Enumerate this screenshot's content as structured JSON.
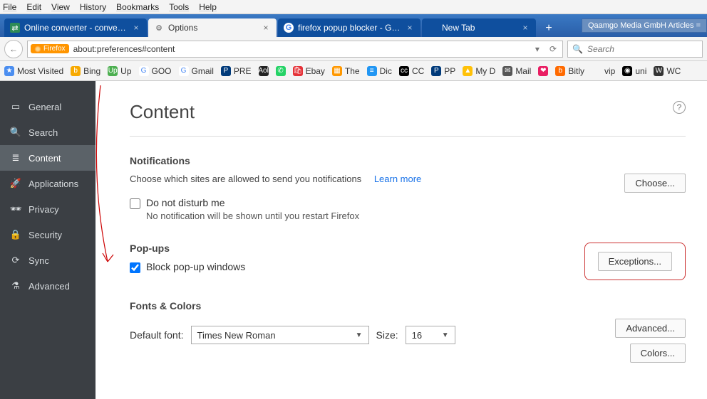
{
  "menu": [
    "File",
    "Edit",
    "View",
    "History",
    "Bookmarks",
    "Tools",
    "Help"
  ],
  "tabs": [
    {
      "title": "Online converter - convert ...",
      "active": false,
      "icon_bg": "#2e8b57",
      "icon_txt": "⇄"
    },
    {
      "title": "Options",
      "active": true,
      "icon_bg": "#888",
      "icon_txt": "⚙"
    },
    {
      "title": "firefox popup blocker - Goo...",
      "active": false,
      "icon_bg": "#fff",
      "icon_txt": "G",
      "icon_color": "#4285F4"
    },
    {
      "title": "New Tab",
      "active": false,
      "icon_bg": "transparent",
      "icon_txt": ""
    }
  ],
  "banner": "Qaamgo Media GmbH Articles =",
  "url": {
    "badge": "Firefox",
    "value": "about:preferences#content",
    "search_placeholder": "Search"
  },
  "bookmarks": [
    {
      "label": "Most Visited",
      "bg": "#4b8ef0",
      "txt": "★"
    },
    {
      "label": "Bing",
      "bg": "#f7a900",
      "txt": "b"
    },
    {
      "label": "Up",
      "bg": "#4caf50",
      "txt": "Up"
    },
    {
      "label": "GOO",
      "bg": "#fff",
      "txt": "G",
      "fg": "#4285F4"
    },
    {
      "label": "Gmail",
      "bg": "#fff",
      "txt": "G",
      "fg": "#4285F4"
    },
    {
      "label": "PRE",
      "bg": "#003a7a",
      "txt": "P"
    },
    {
      "label": "",
      "bg": "#222",
      "txt": "Aol"
    },
    {
      "label": "",
      "bg": "#25d366",
      "txt": "✆"
    },
    {
      "label": "Ebay",
      "bg": "#e53238",
      "txt": "🛍"
    },
    {
      "label": "The",
      "bg": "#ff9800",
      "txt": "▦"
    },
    {
      "label": "Dic",
      "bg": "#2196f3",
      "txt": "≡"
    },
    {
      "label": "CC",
      "bg": "#000",
      "txt": "cc"
    },
    {
      "label": "PP",
      "bg": "#003a7a",
      "txt": "P"
    },
    {
      "label": "My D",
      "bg": "#ffc107",
      "txt": "▲"
    },
    {
      "label": "Mail",
      "bg": "#555",
      "txt": "✉"
    },
    {
      "label": "",
      "bg": "#e91e63",
      "txt": "❤"
    },
    {
      "label": "Bitly",
      "bg": "#ff6a00",
      "txt": "b"
    },
    {
      "label": "vip",
      "bg": "transparent",
      "txt": "",
      "fg": "#333"
    },
    {
      "label": "uni",
      "bg": "#000",
      "txt": "◉"
    },
    {
      "label": "WC",
      "bg": "#333",
      "txt": "W"
    }
  ],
  "sidebar": [
    {
      "label": "General",
      "icon": "▭"
    },
    {
      "label": "Search",
      "icon": "🔍"
    },
    {
      "label": "Content",
      "icon": "≣",
      "active": true
    },
    {
      "label": "Applications",
      "icon": "🚀"
    },
    {
      "label": "Privacy",
      "icon": "🕶"
    },
    {
      "label": "Security",
      "icon": "🔒"
    },
    {
      "label": "Sync",
      "icon": "⟳"
    },
    {
      "label": "Advanced",
      "icon": "⚗"
    }
  ],
  "page": {
    "title": "Content",
    "sections": {
      "notifications": {
        "heading": "Notifications",
        "desc": "Choose which sites are allowed to send you notifications",
        "learn": "Learn more",
        "choose_btn": "Choose...",
        "dnd_label": "Do not disturb me",
        "dnd_sub": "No notification will be shown until you restart Firefox"
      },
      "popups": {
        "heading": "Pop-ups",
        "block_label": "Block pop-up windows",
        "exceptions_btn": "Exceptions..."
      },
      "fonts": {
        "heading": "Fonts & Colors",
        "default_font_label": "Default font:",
        "font_value": "Times New Roman",
        "size_label": "Size:",
        "size_value": "16",
        "advanced_btn": "Advanced...",
        "colors_btn": "Colors..."
      }
    }
  }
}
